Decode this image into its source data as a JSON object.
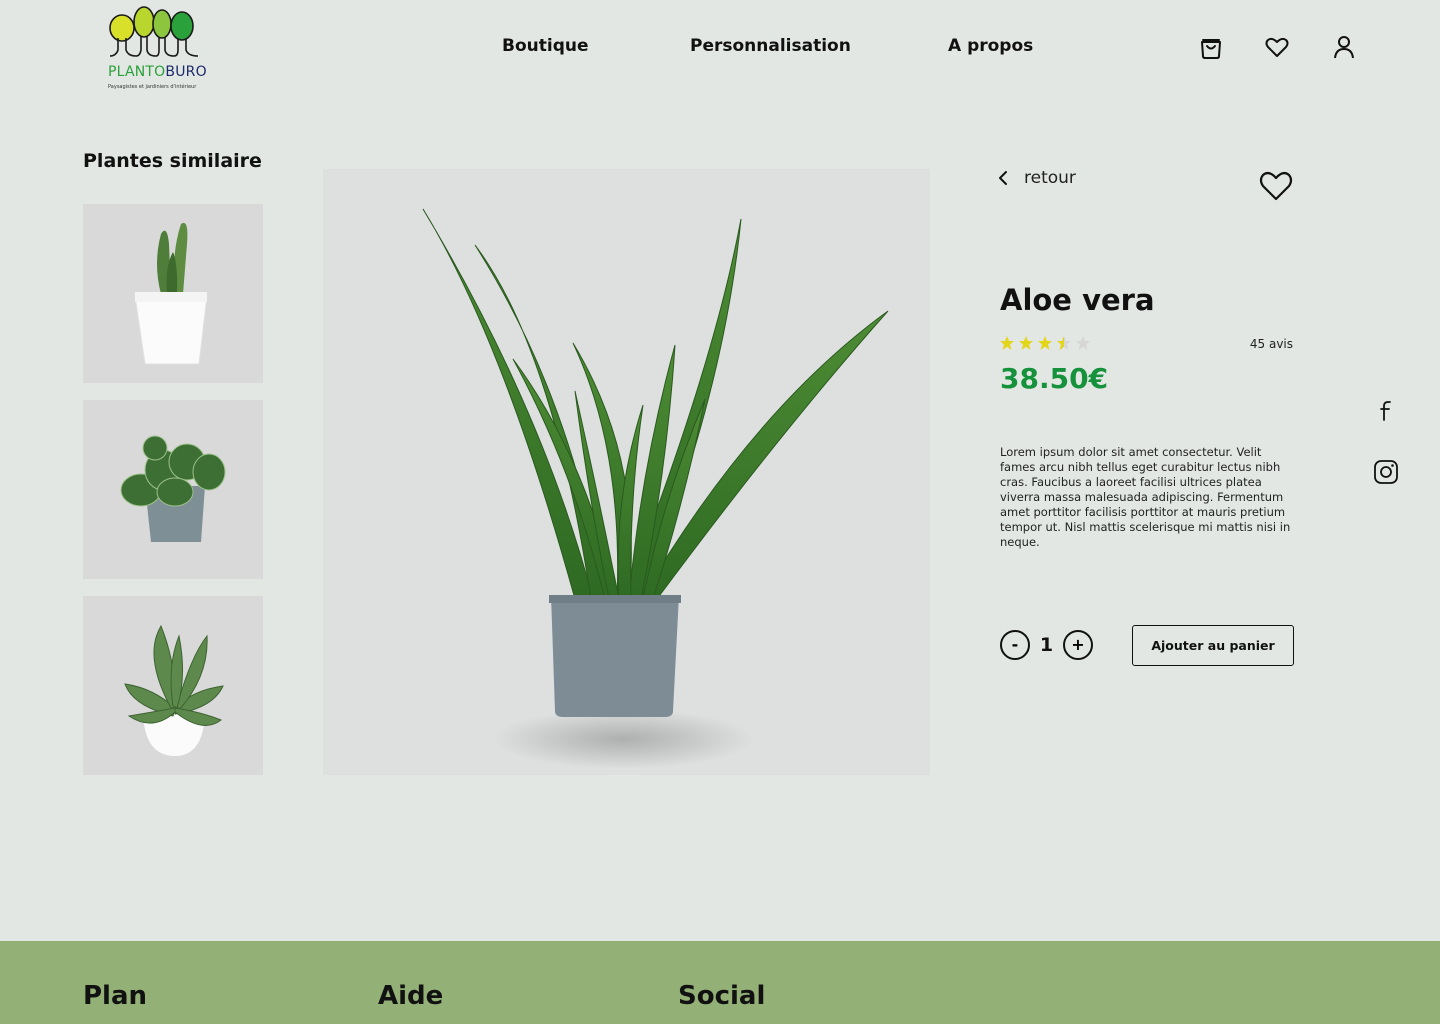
{
  "brand": {
    "name_part1": "PLANTO",
    "name_part2": "BURO",
    "tagline": "Paysagistes et jardiniers d'intérieur",
    "colors": {
      "green": "#2aa13a",
      "navy": "#1d2a6b",
      "yellow": "#d8e02a"
    }
  },
  "nav": {
    "links": [
      "Boutique",
      "Personnalisation",
      "A propos"
    ],
    "icons": [
      "shopping-bag-icon",
      "heart-icon",
      "user-icon"
    ]
  },
  "similar": {
    "title": "Plantes similaire",
    "items": [
      "cactus-in-white-pot",
      "peperomia-in-grey-pot",
      "succulent-in-white-pot"
    ]
  },
  "product": {
    "back_label": "retour",
    "title": "Aloe vera",
    "rating": 3.5,
    "rating_max": 5,
    "reviews": "45 avis",
    "price": "38.50€",
    "description": "Lorem ipsum dolor sit amet consectetur. Velit fames arcu nibh tellus eget curabitur lectus nibh cras. Faucibus a laoreet facilisi ultrices platea viverra massa malesuada adipiscing. Fermentum amet porttitor facilisis porttitor at mauris pretium tempor ut. Nisl mattis scelerisque mi mattis nisi in neque.",
    "quantity": "1",
    "minus_label": "-",
    "plus_label": "+",
    "add_to_cart_label": "Ajouter au panier"
  },
  "social_icons": [
    "facebook-icon",
    "instagram-icon"
  ],
  "footer": {
    "headings": [
      "Plan",
      "Aide",
      "Social"
    ]
  },
  "colors": {
    "background": "#e3e7e3",
    "price": "#16923c",
    "star": "#e3d51a",
    "footer": "#93b077"
  }
}
